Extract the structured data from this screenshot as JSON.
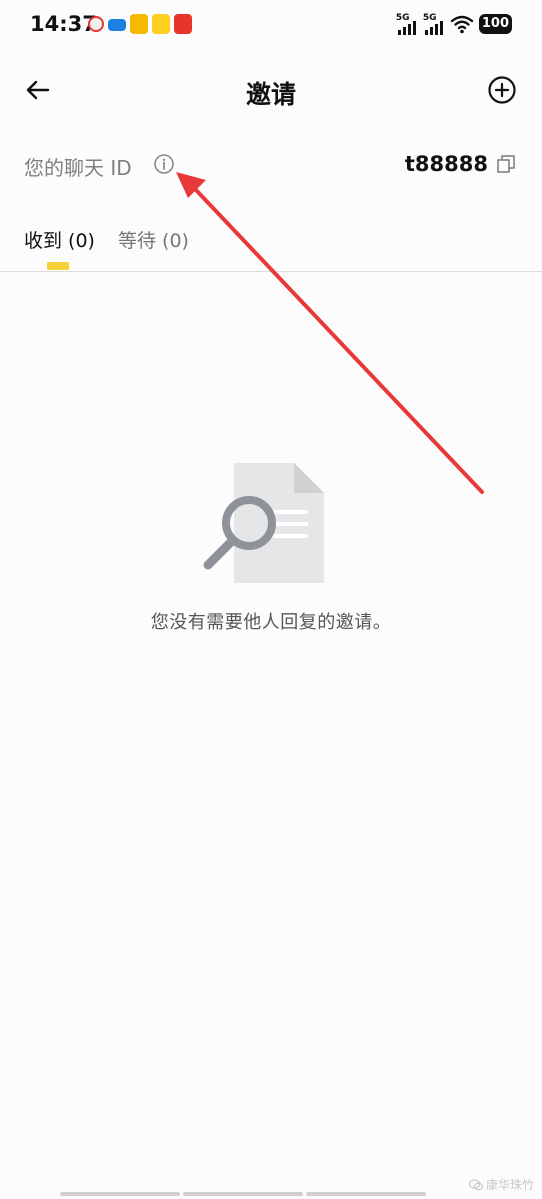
{
  "status_bar": {
    "time": "14:37",
    "signal_1_label": "5G",
    "signal_2_label": "5G",
    "battery": "100"
  },
  "header": {
    "title": "邀请"
  },
  "chat_id": {
    "label": "您的聊天 ID",
    "value": "t88888"
  },
  "tabs": [
    {
      "label": "收到 (0)"
    },
    {
      "label": "等待 (0)"
    }
  ],
  "empty_state": {
    "message": "您没有需要他人回复的邀请。"
  },
  "watermark": {
    "text": "康华珠竹"
  },
  "colors": {
    "accent_indicator": "#f4d238",
    "annotation_arrow": "#e8393a"
  }
}
